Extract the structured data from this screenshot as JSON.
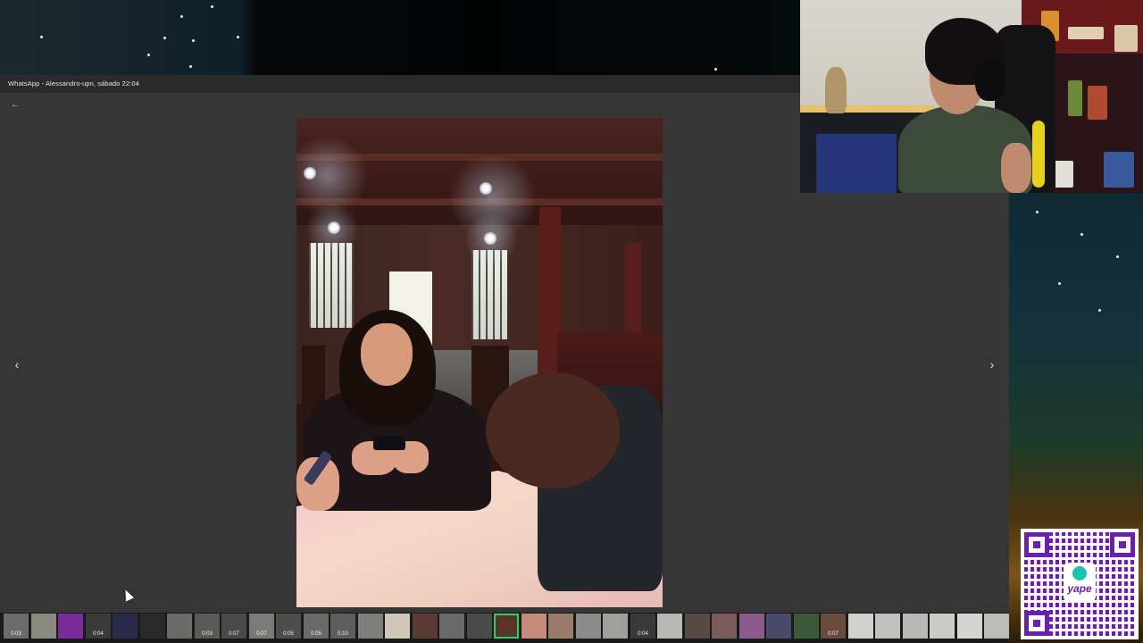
{
  "window": {
    "title": "WhatsApp - Alessandro-upn, sábado 22:04"
  },
  "viewer": {
    "back_icon": "arrow-left-icon",
    "prev_icon": "chevron-left-icon",
    "next_icon": "chevron-right-icon",
    "back_glyph": "←",
    "prev_glyph": "‹",
    "next_glyph": "›"
  },
  "qr": {
    "logo_text": "yape"
  },
  "filmstrip": {
    "thumbs": [
      {
        "color": "#6b6b6b",
        "duration": "0:03"
      },
      {
        "color": "#8a8a7e",
        "duration": ""
      },
      {
        "color": "#7a2a9a",
        "duration": ""
      },
      {
        "color": "#3a3a3a",
        "duration": "0:04"
      },
      {
        "color": "#2a2a4a",
        "duration": ""
      },
      {
        "color": "#2a2a2a",
        "duration": ""
      },
      {
        "color": "#6a6a66",
        "duration": ""
      },
      {
        "color": "#5a5a56",
        "duration": "0:03"
      },
      {
        "color": "#4a4a48",
        "duration": "0:07"
      },
      {
        "color": "#7a7a76",
        "duration": "0:07"
      },
      {
        "color": "#4e4e4c",
        "duration": "0:05"
      },
      {
        "color": "#6a6a68",
        "duration": "0:05"
      },
      {
        "color": "#5e5e5c",
        "duration": "0:10"
      },
      {
        "color": "#7e7e7c",
        "duration": ""
      },
      {
        "color": "#cfc6b8",
        "duration": ""
      },
      {
        "color": "#5a3a32",
        "duration": ""
      },
      {
        "color": "#6a6a6a",
        "duration": ""
      },
      {
        "color": "#4a4a4a",
        "duration": ""
      },
      {
        "color": "#5a3228",
        "duration": "",
        "active": true
      },
      {
        "color": "#c48a7a",
        "duration": ""
      },
      {
        "color": "#9a7a6a",
        "duration": ""
      },
      {
        "color": "#8a8a8a",
        "duration": ""
      },
      {
        "color": "#a0a09a",
        "duration": ""
      },
      {
        "color": "#3a3a3a",
        "duration": "0:04"
      },
      {
        "color": "#b8b8b4",
        "duration": ""
      },
      {
        "color": "#5a4a44",
        "duration": ""
      },
      {
        "color": "#7a5a5a",
        "duration": ""
      },
      {
        "color": "#8a5a8a",
        "duration": ""
      },
      {
        "color": "#4a4a6a",
        "duration": ""
      },
      {
        "color": "#3a5a3a",
        "duration": ""
      },
      {
        "color": "#6a4a3a",
        "duration": "0:07"
      },
      {
        "color": "#d0d0cc",
        "duration": ""
      },
      {
        "color": "#c0c0bc",
        "duration": ""
      },
      {
        "color": "#b8b8b4",
        "duration": ""
      },
      {
        "color": "#cacac6",
        "duration": ""
      },
      {
        "color": "#d4d4d0",
        "duration": ""
      },
      {
        "color": "#bcbcb8",
        "duration": ""
      }
    ]
  }
}
